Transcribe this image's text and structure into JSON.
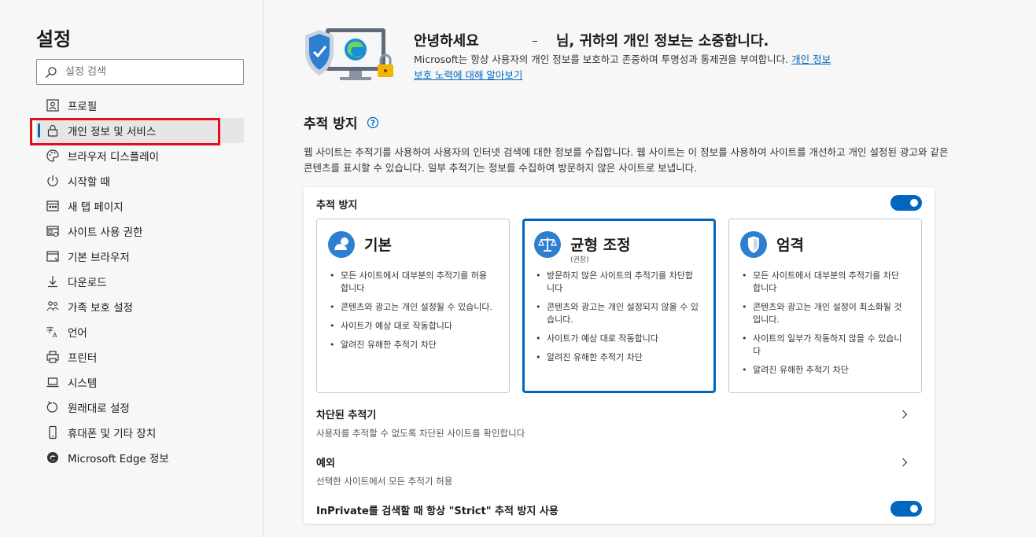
{
  "sidebar": {
    "title": "설정",
    "search_placeholder": "설정 검색",
    "items": [
      {
        "label": "프로필",
        "icon": "profile-icon"
      },
      {
        "label": "개인 정보 및 서비스",
        "icon": "lock-icon",
        "active": true
      },
      {
        "label": "브라우저 디스플레이",
        "icon": "palette-icon"
      },
      {
        "label": "시작할 때",
        "icon": "power-icon"
      },
      {
        "label": "새 탭 페이지",
        "icon": "new-tab-icon"
      },
      {
        "label": "사이트 사용 권한",
        "icon": "site-permissions-icon"
      },
      {
        "label": "기본 브라우저",
        "icon": "browser-icon"
      },
      {
        "label": "다운로드",
        "icon": "download-icon"
      },
      {
        "label": "가족 보호 설정",
        "icon": "family-icon"
      },
      {
        "label": "언어",
        "icon": "language-icon"
      },
      {
        "label": "프린터",
        "icon": "printer-icon"
      },
      {
        "label": "시스템",
        "icon": "laptop-icon"
      },
      {
        "label": "원래대로 설정",
        "icon": "reset-icon"
      },
      {
        "label": "휴대폰 및 기타 장치",
        "icon": "phone-icon"
      },
      {
        "label": "Microsoft Edge 정보",
        "icon": "edge-icon"
      }
    ]
  },
  "hero": {
    "greeting_before": "안녕하세요",
    "greeting_after": "님, 귀하의 개인 정보는 소중합니다.",
    "description": "Microsoft는 항상 사용자의 개인 정보를 보호하고 존중하며 투명성과 통제권을 부여합니다.",
    "link": "개인 정보 보호 노력에 대해 알아보기"
  },
  "tracking": {
    "section_title": "추적 방지",
    "section_description": "웹 사이트는 추적기를 사용하여 사용자의 인터넷 검색에 대한 정보를 수집합니다. 웹 사이트는 이 정보를 사용하여 사이트를 개선하고 개인 설정된 광고와 같은 콘텐츠를 표시할 수 있습니다. 일부 추적기는 정보를 수집하여 방문하지 않은 사이트로 보냅니다.",
    "card_title": "추적 방지",
    "enabled": true,
    "levels": [
      {
        "name": "기본",
        "subtitle": "",
        "bullets": [
          "모든 사이트에서 대부분의 추적기를 허용합니다",
          "콘텐츠와 광고는 개인 설정될 수 있습니다.",
          "사이트가 예상 대로 작동합니다",
          "알려진 유해한 추적기 차단"
        ]
      },
      {
        "name": "균형 조정",
        "subtitle": "(권장)",
        "selected": true,
        "bullets": [
          "방문하지 않은 사이트의 추적기를 차단합니다",
          "콘텐츠와 광고는 개인 설정되지 않을 수 있습니다.",
          "사이트가 예상 대로 작동합니다",
          "알려진 유해한 추적기 차단"
        ]
      },
      {
        "name": "엄격",
        "subtitle": "",
        "bullets": [
          "모든 사이트에서 대부분의 추적기를 차단합니다",
          "콘텐츠와 광고는 개인 설정이 최소화될 것입니다.",
          "사이트의 일부가 작동하지 않을 수 있습니다",
          "알려진 유해한 추적기 차단"
        ]
      }
    ],
    "blocked_title": "차단된 추적기",
    "blocked_desc": "사용자를 추적할 수 없도록 차단된 사이트를 확인합니다",
    "exceptions_title": "예외",
    "exceptions_desc": "선택한 사이트에서 모든 추적기 허용",
    "inprivate_label": "InPrivate를 검색할 때 항상 \"Strict\" 추적 방지 사용",
    "inprivate_enabled": true
  },
  "colors": {
    "accent": "#0067c0",
    "highlight": "#e0111b"
  }
}
